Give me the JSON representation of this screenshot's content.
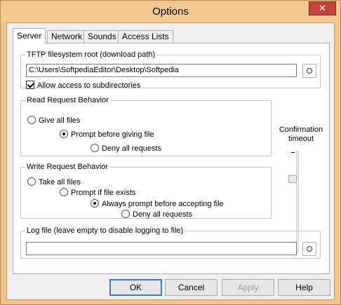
{
  "window": {
    "title": "Options",
    "close_glyph": "✕"
  },
  "tabs": [
    {
      "label": "Server",
      "active": true
    },
    {
      "label": "Network"
    },
    {
      "label": "Sounds"
    },
    {
      "label": "Access Lists"
    }
  ],
  "tftp_root": {
    "legend": "TFTP filesystem root (download path)",
    "path_value": "C:\\Users\\SoftpediaEditor\\Desktop\\Softpedia",
    "allow_subdirs_label": "Allow access to subdirectories",
    "allow_subdirs_checked": true
  },
  "read_request": {
    "legend": "Read Request Behavior",
    "options": [
      "Give all files",
      "Prompt before giving file",
      "Deny all requests"
    ],
    "selected": "Prompt before giving file"
  },
  "write_request": {
    "legend": "Write Request Behavior",
    "options": [
      "Take all files",
      "Prompt if file exists",
      "Always prompt before accepting file",
      "Deny all requests"
    ],
    "selected": "Always prompt before accepting file"
  },
  "confirmation": {
    "label_line1": "Confirmation",
    "label_line2": "timeout"
  },
  "log_file": {
    "legend": "Log file (leave empty to disable logging to file)",
    "value": ""
  },
  "buttons": {
    "ok": "OK",
    "cancel": "Cancel",
    "apply": "Apply",
    "help": "Help"
  }
}
